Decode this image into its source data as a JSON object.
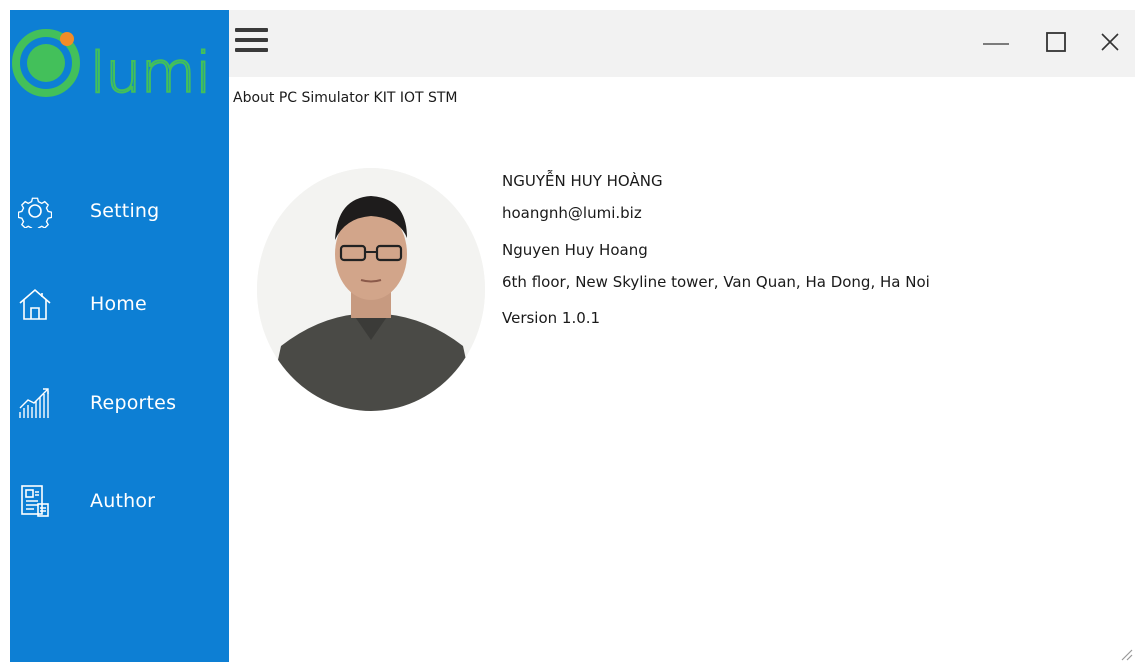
{
  "app": {
    "logo_text": "lumi"
  },
  "sidebar": {
    "items": [
      {
        "label": "Setting",
        "icon": "gear-icon"
      },
      {
        "label": "Home",
        "icon": "home-icon"
      },
      {
        "label": "Reportes",
        "icon": "chart-icon"
      },
      {
        "label": "Author",
        "icon": "id-card-icon"
      }
    ]
  },
  "titlebar": {
    "menu_icon": "hamburger-icon",
    "controls": [
      "minimize-icon",
      "maximize-icon",
      "close-icon"
    ]
  },
  "page": {
    "heading": "About PC Simulator KIT IOT STM"
  },
  "author": {
    "name_upper": "NGUYỄN HUY HOÀNG",
    "email": "hoangnh@lumi.biz",
    "name": "Nguyen Huy Hoang",
    "address": "6th floor, New Skyline tower, Van Quan, Ha Dong, Ha Noi",
    "version": "Version 1.0.1"
  },
  "colors": {
    "sidebar_bg": "#0d7fd4",
    "logo_green": "#34c759",
    "logo_orange": "#f28c28",
    "titlebar_bg": "#f2f2f2"
  }
}
